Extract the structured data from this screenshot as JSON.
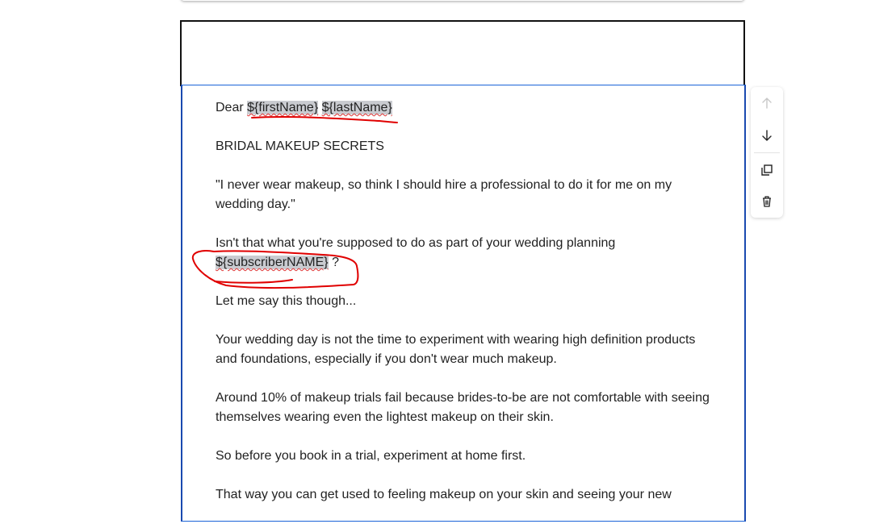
{
  "email": {
    "greeting_prefix": "Dear ",
    "first_name_tag": "${firstName}",
    "last_name_tag": "${lastName}",
    "heading": "BRIDAL MAKEUP SECRETS",
    "quote": "\"I never wear makeup, so think I should hire a professional to do it for me on my wedding day.\"",
    "planning_text": "Isn't that what you're supposed to do as part of your wedding planning",
    "subscriber_tag": "${subscriberNAME}",
    "planning_suffix": " ?",
    "say_this": "Let me say this though...",
    "wedding_day": "Your wedding day is not the time to experiment with wearing high definition products and foundations, especially if you don't wear much makeup.",
    "trials": "Around 10% of makeup trials fail because brides-to-be are not comfortable with seeing themselves wearing even the lightest makeup on their skin.",
    "before_trial": "So before you book in a trial, experiment at home first.",
    "that_way": "That way you can get used to feeling makeup on your skin and seeing your new"
  },
  "toolbar": {
    "icons": [
      "arrow-up-icon",
      "arrow-down-icon",
      "duplicate-icon",
      "trash-icon"
    ]
  },
  "colors": {
    "selection_border": "#1a63d8",
    "annotation_red": "#e00000",
    "merge_tag_bg": "#c9cbd0"
  }
}
